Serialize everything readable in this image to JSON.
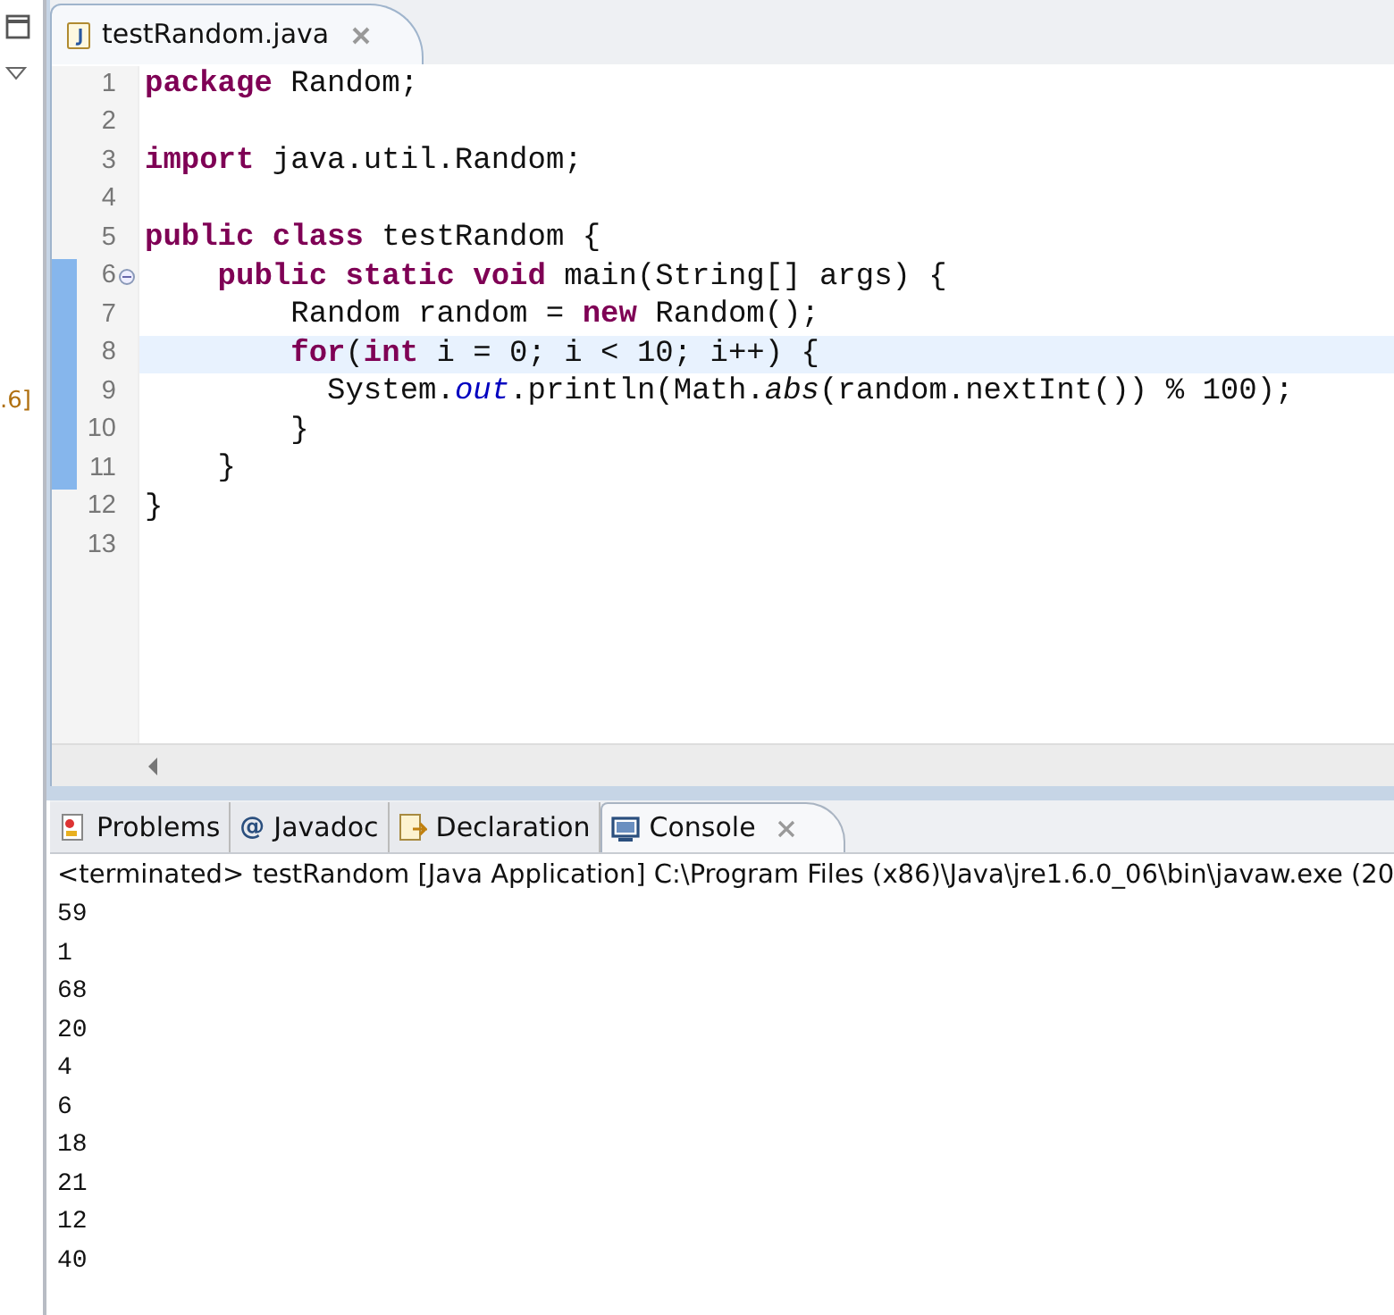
{
  "left_panel": {
    "label": ".6]"
  },
  "editor": {
    "tab": {
      "title": "testRandom.java",
      "selected": true
    },
    "lines": [
      {
        "number": "1",
        "changed": false,
        "current": false,
        "fold": false,
        "tokens": [
          {
            "kind": "keyword",
            "text": "package"
          },
          {
            "kind": "plain",
            "text": " Random;"
          }
        ]
      },
      {
        "number": "2",
        "changed": false,
        "current": false,
        "fold": false
      },
      {
        "number": "3",
        "changed": false,
        "current": false,
        "fold": false,
        "tokens": [
          {
            "kind": "keyword",
            "text": "import"
          },
          {
            "kind": "plain",
            "text": " java.util.Random;"
          }
        ]
      },
      {
        "number": "4",
        "changed": false,
        "current": false,
        "fold": false
      },
      {
        "number": "5",
        "changed": false,
        "current": false,
        "fold": false,
        "tokens": [
          {
            "kind": "keyword",
            "text": "public class"
          },
          {
            "kind": "plain",
            "text": " testRandom {"
          }
        ]
      },
      {
        "number": "6",
        "changed": true,
        "current": false,
        "fold": true,
        "tokens": [
          {
            "kind": "keyword",
            "text": "    public static void"
          },
          {
            "kind": "plain",
            "text": " main(String[] args) {"
          }
        ]
      },
      {
        "number": "7",
        "changed": true,
        "current": false,
        "fold": false,
        "tokens": [
          {
            "kind": "plain",
            "text": "        Random random = "
          },
          {
            "kind": "keyword",
            "text": "new"
          },
          {
            "kind": "plain",
            "text": " Random();"
          }
        ]
      },
      {
        "number": "8",
        "changed": true,
        "current": true,
        "fold": false,
        "tokens": [
          {
            "kind": "keyword",
            "text": "        for"
          },
          {
            "kind": "plain",
            "text": "("
          },
          {
            "kind": "keyword",
            "text": "int"
          },
          {
            "kind": "plain",
            "text": " i = 0; i < 10; i++) {"
          }
        ]
      },
      {
        "number": "9",
        "changed": true,
        "current": false,
        "fold": false,
        "tokens": [
          {
            "kind": "plain",
            "text": "          System."
          },
          {
            "kind": "static_field",
            "text": "out"
          },
          {
            "kind": "plain",
            "text": ".println(Math."
          },
          {
            "kind": "static_method",
            "text": "abs"
          },
          {
            "kind": "plain",
            "text": "(random.nextInt()) % 100);"
          }
        ]
      },
      {
        "number": "10",
        "changed": true,
        "current": false,
        "fold": false,
        "tokens": [
          {
            "kind": "plain",
            "text": "        }"
          }
        ]
      },
      {
        "number": "11",
        "changed": true,
        "current": false,
        "fold": false,
        "tokens": [
          {
            "kind": "plain",
            "text": "    }"
          }
        ]
      },
      {
        "number": "12",
        "changed": false,
        "current": false,
        "fold": false,
        "tokens": [
          {
            "kind": "plain",
            "text": "}"
          }
        ]
      },
      {
        "number": "13",
        "changed": false,
        "current": false,
        "fold": false
      }
    ]
  },
  "bottom_panel": {
    "tabs": [
      {
        "label": "Problems",
        "kind": "problems",
        "selected": false
      },
      {
        "label": "Javadoc",
        "kind": "javadoc",
        "glyph": "@",
        "selected": false
      },
      {
        "label": "Declaration",
        "kind": "declaration",
        "selected": false
      },
      {
        "label": "Console",
        "kind": "console",
        "selected": true
      }
    ],
    "console_header": "<terminated> testRandom [Java Application] C:\\Program Files (x86)\\Java\\jre1.6.0_06\\bin\\javaw.exe (20",
    "output": [
      "59",
      "1",
      "68",
      "20",
      "4",
      "6",
      "18",
      "21",
      "12",
      "40"
    ]
  }
}
